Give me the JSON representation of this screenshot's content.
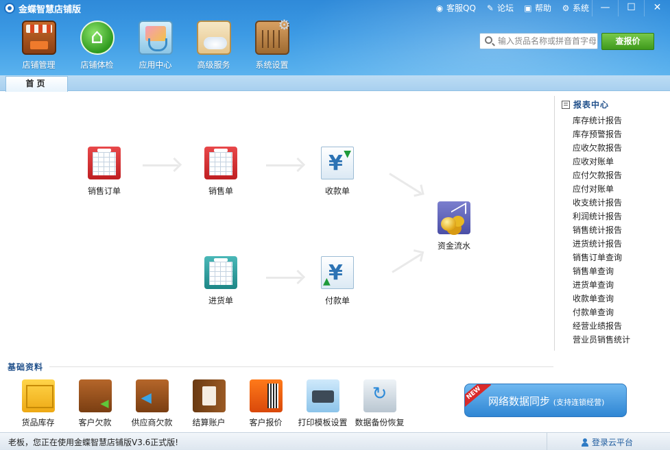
{
  "app": {
    "title": "金蝶智慧店铺版"
  },
  "top_links": [
    {
      "label": "客服QQ",
      "icon": "qq-icon"
    },
    {
      "label": "论坛",
      "icon": "forum-icon"
    },
    {
      "label": "帮助",
      "icon": "help-icon"
    },
    {
      "label": "系统",
      "icon": "gear-icon"
    }
  ],
  "window_buttons": {
    "minimize": "—",
    "maximize": "☐",
    "close": "✕"
  },
  "main_nav": [
    {
      "label": "店铺管理",
      "icon": "store-icon"
    },
    {
      "label": "店铺体检",
      "icon": "home-check-icon"
    },
    {
      "label": "应用中心",
      "icon": "app-center-icon"
    },
    {
      "label": "高级服务",
      "icon": "advanced-service-icon"
    },
    {
      "label": "系统设置",
      "icon": "system-settings-icon"
    }
  ],
  "search": {
    "placeholder": "输入货品名称或拼音首字母"
  },
  "price_button": "查报价",
  "tabs": [
    {
      "label": "首页",
      "active": true
    }
  ],
  "workflow": {
    "sales_order": "销售订单",
    "sales_slip": "销售单",
    "receipt": "收款单",
    "cash_flow": "资金流水",
    "purchase_slip": "进货单",
    "payment": "付款单"
  },
  "report_center": {
    "title": "报表中心",
    "items": [
      "库存统计报告",
      "库存预警报告",
      "应收欠款报告",
      "应收对账单",
      "应付欠款报告",
      "应付对账单",
      "收支统计报告",
      "利润统计报告",
      "销售统计报告",
      "进货统计报告",
      "销售订单查询",
      "销售单查询",
      "进货单查询",
      "收款单查询",
      "付款单查询",
      "经营业绩报告",
      "营业员销售统计"
    ]
  },
  "basic_data": {
    "title": "基础资料",
    "items": [
      {
        "label": "货品库存",
        "icon": "goods-stock-icon"
      },
      {
        "label": "客户欠款",
        "icon": "customer-debt-icon"
      },
      {
        "label": "供应商欠款",
        "icon": "supplier-debt-icon"
      },
      {
        "label": "结算账户",
        "icon": "settlement-account-icon"
      },
      {
        "label": "客户报价",
        "icon": "customer-quote-icon"
      },
      {
        "label": "打印模板设置",
        "icon": "printer-icon"
      },
      {
        "label": "数据备份恢复",
        "icon": "backup-restore-icon"
      }
    ]
  },
  "sync_banner": {
    "badge": "NEW",
    "main": "网络数据同步",
    "sub": "(支持连锁经营)"
  },
  "status": {
    "text": "老板，您正在使用金蝶智慧店铺版V3.6正式版!",
    "login": "登录云平台"
  },
  "colors": {
    "header": "#3c9ae4",
    "accent_green": "#3f9a1c",
    "link_blue": "#1f4f8a"
  }
}
